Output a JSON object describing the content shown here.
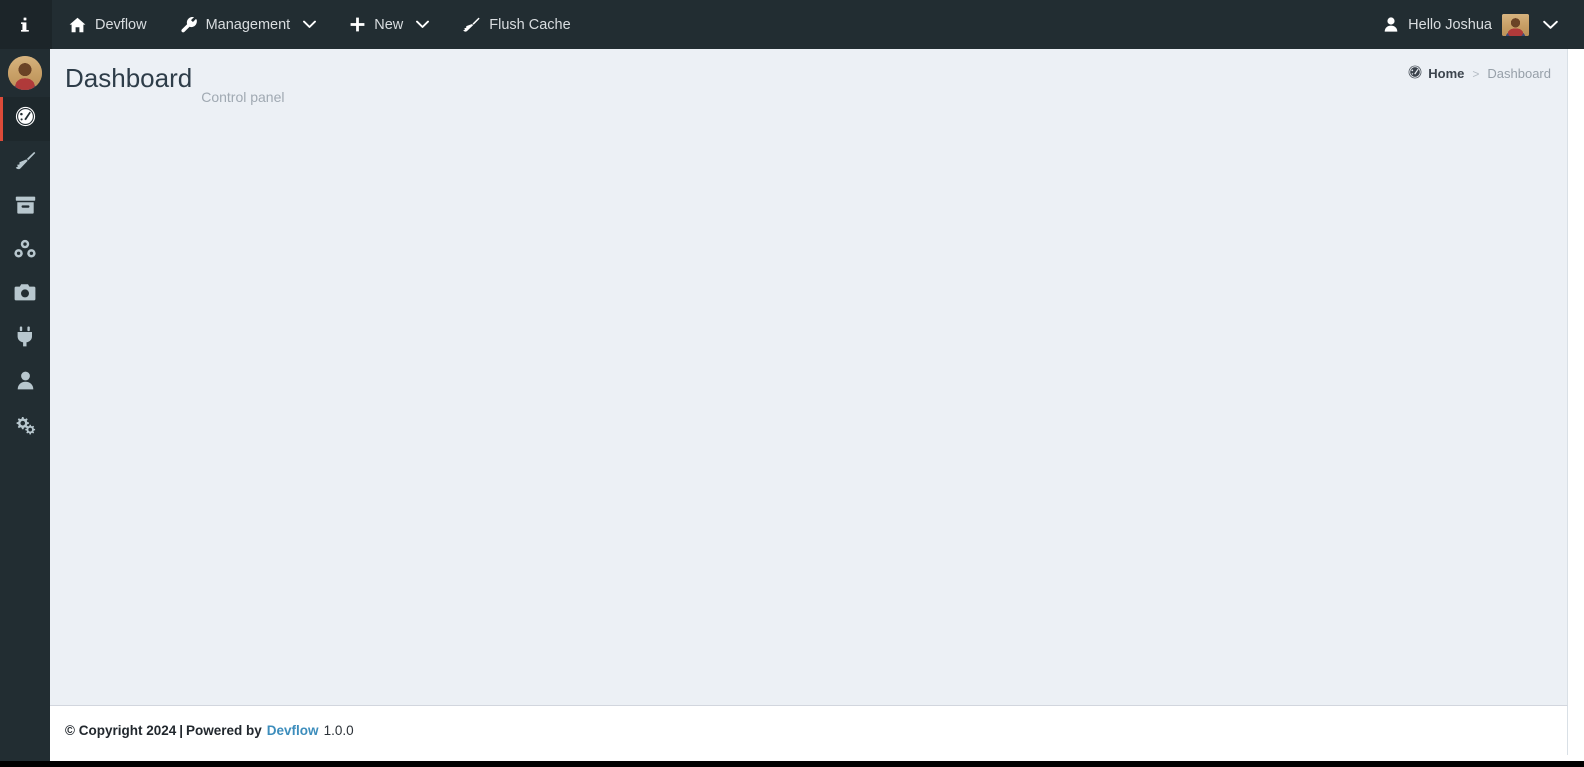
{
  "topbar": {
    "info_icon_label": "i",
    "items": [
      {
        "label": "Devflow",
        "icon": "home-icon",
        "has_caret": false
      },
      {
        "label": "Management",
        "icon": "wrench-icon",
        "has_caret": true
      },
      {
        "label": "New",
        "icon": "plus-icon",
        "has_caret": true
      },
      {
        "label": "Flush Cache",
        "icon": "broom-icon",
        "has_caret": false
      }
    ],
    "user": {
      "greeting": "Hello Joshua",
      "icon": "user-icon",
      "caret": "chevron-down-icon"
    }
  },
  "sidebar": {
    "avatar_name": "user-avatar",
    "items": [
      {
        "name": "sidebar-item-dashboard",
        "icon": "dashboard-gauge-icon",
        "active": true
      },
      {
        "name": "sidebar-item-flush-cache",
        "icon": "broom-icon",
        "active": false
      },
      {
        "name": "sidebar-item-archive",
        "icon": "archive-box-icon",
        "active": false
      },
      {
        "name": "sidebar-item-modules",
        "icon": "cubes-icon",
        "active": false
      },
      {
        "name": "sidebar-item-media",
        "icon": "camera-icon",
        "active": false
      },
      {
        "name": "sidebar-item-plugins",
        "icon": "plug-icon",
        "active": false
      },
      {
        "name": "sidebar-item-users",
        "icon": "user-icon",
        "active": false
      },
      {
        "name": "sidebar-item-settings",
        "icon": "gears-icon",
        "active": false
      }
    ]
  },
  "page": {
    "title": "Dashboard",
    "subtitle": "Control panel"
  },
  "breadcrumb": {
    "home_icon": "dashboard-gauge-icon",
    "home_label": "Home",
    "separator": ">",
    "current_label": "Dashboard"
  },
  "footer": {
    "copyright": "© Copyright 2024",
    "separator": "|",
    "powered_by": "Powered by",
    "brand": "Devflow",
    "version": "1.0.0"
  },
  "colors": {
    "navbar_bg": "#222d32",
    "sidebar_bg": "#222d32",
    "content_bg": "#ecf0f5",
    "accent_red": "#dd4b39",
    "link_blue": "#3c8dbc",
    "title_text": "#2e3d49",
    "muted_text": "#a0a9b2"
  }
}
